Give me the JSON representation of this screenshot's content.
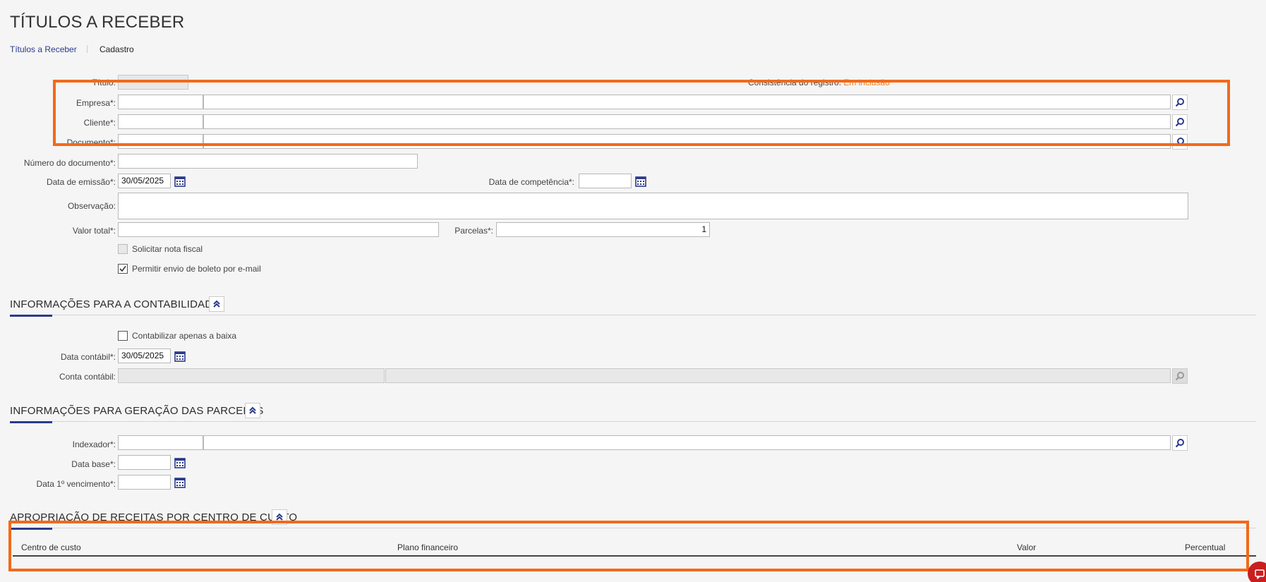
{
  "page": {
    "title": "TÍTULOS A RECEBER"
  },
  "breadcrumb": {
    "link": "Títulos a Receber",
    "current": "Cadastro"
  },
  "form": {
    "titulo_label": "Título:",
    "consistencia_label": "Consistência do registro:",
    "consistencia_value": "Em inclusão",
    "empresa_label": "Empresa*:",
    "cliente_label": "Cliente*:",
    "documento_label": "Documento*:",
    "numero_doc_label": "Número do documento*:",
    "data_emissao_label": "Data de emissão*:",
    "data_emissao_value": "30/05/2025",
    "data_competencia_label": "Data de competência*:",
    "observacao_label": "Observação:",
    "valor_total_label": "Valor total*:",
    "parcelas_label": "Parcelas*:",
    "parcelas_value": "1",
    "solicitar_nf_label": "Solicitar nota fiscal",
    "permitir_boleto_label": "Permitir envio de boleto por e-mail"
  },
  "contabilidade": {
    "title": "INFORMAÇÕES PARA A CONTABILIDADE",
    "contabilizar_label": "Contabilizar apenas a baixa",
    "data_contabil_label": "Data contábil*:",
    "data_contabil_value": "30/05/2025",
    "conta_contabil_label": "Conta contábil:"
  },
  "parcelas_sec": {
    "title": "INFORMAÇÕES PARA GERAÇÃO DAS PARCELAS",
    "indexador_label": "Indexador*:",
    "data_base_label": "Data base*:",
    "data_venc_label": "Data 1º vencimento*:"
  },
  "apropriacao": {
    "title": "APROPRIAÇÃO DE RECEITAS POR CENTRO DE CUSTO",
    "columns": [
      "Centro de custo",
      "Plano financeiro",
      "Valor",
      "Percentual"
    ]
  },
  "colors": {
    "accent": "#2a3a8c",
    "highlight": "#f26a1b",
    "status": "#e8801f"
  }
}
